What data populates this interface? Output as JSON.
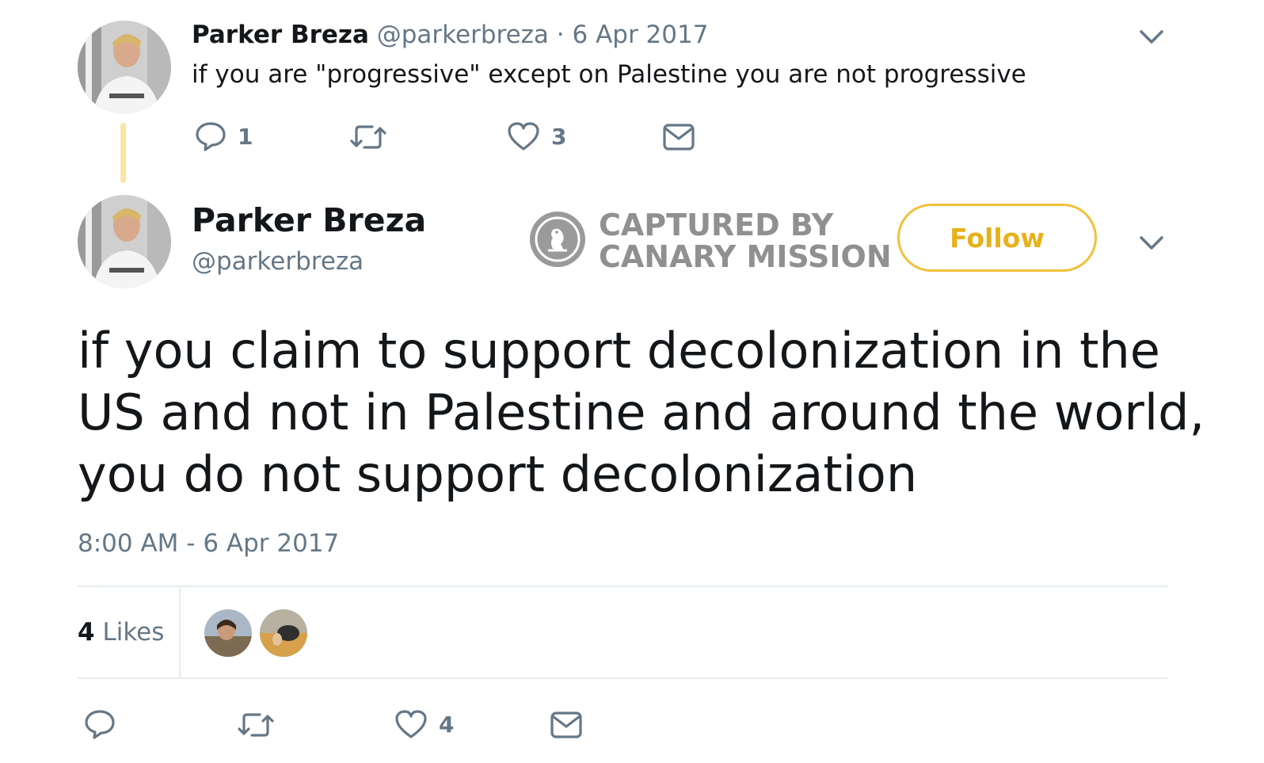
{
  "parent_tweet": {
    "display_name": "Parker Breza",
    "handle": "@parkerbreza",
    "separator": "·",
    "date": "6 Apr 2017",
    "text": "if you are \"progressive\" except on Palestine you are not progressive",
    "reply_count": "1",
    "like_count": "3"
  },
  "main_tweet": {
    "display_name": "Parker Breza",
    "handle": "@parkerbreza",
    "follow_label": "Follow",
    "text": "if you claim to support decolonization in the US and not in Palestine and around the world, you do not support decolonization",
    "text_lines": [
      "if you claim to support decolonization in the",
      "US and not in Palestine and around the world,",
      "you do not support decolonization"
    ],
    "timestamp": "8:00 AM - 6 Apr 2017",
    "likes_count": "4",
    "likes_label": "Likes",
    "like_count": "4"
  },
  "watermark": {
    "line1": "CAPTURED BY",
    "line2": "CANARY MISSION"
  },
  "colors": {
    "follow_accent": "#f2c13a",
    "thread_line": "#fbe4a4",
    "muted_text": "#657786",
    "primary_text": "#14171a"
  },
  "icons": [
    "reply-icon",
    "retweet-icon",
    "like-icon",
    "direct-message-icon",
    "chevron-down-icon",
    "canary-mission-logo-icon"
  ]
}
